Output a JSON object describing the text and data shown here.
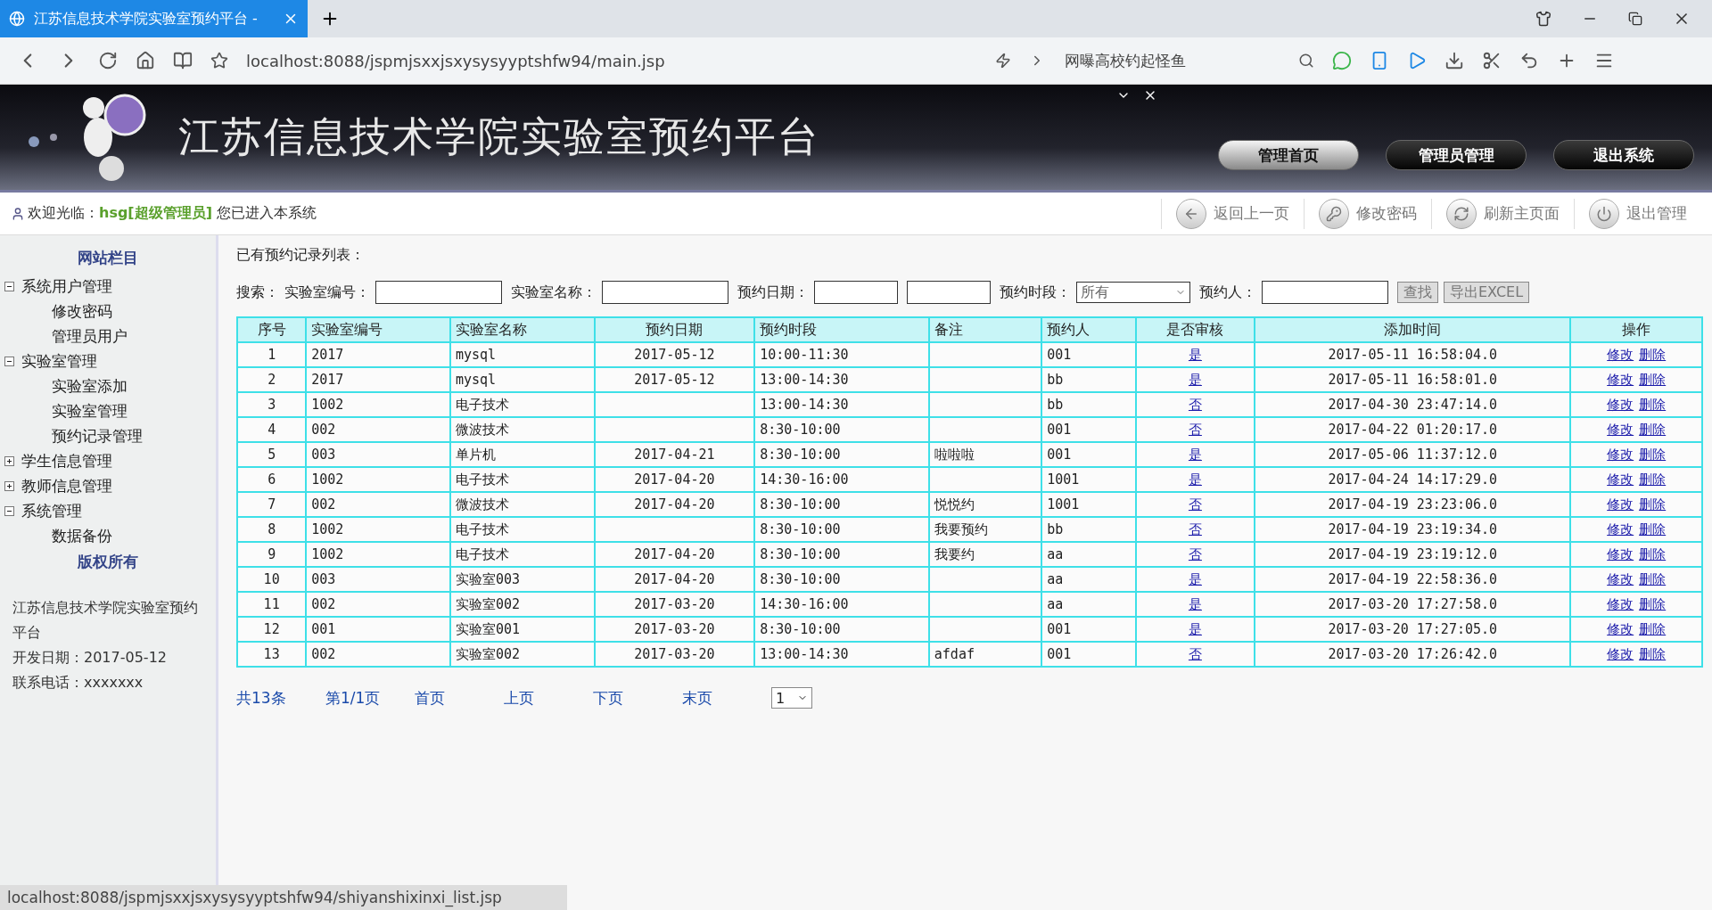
{
  "browser": {
    "tab_title": "江苏信息技术学院实验室预约平台 -",
    "url": "localhost:8088/jspmjsxxjsxysysyyptshfw94/main.jsp",
    "search": {
      "placeholder": "网曝高校钓起怪鱼"
    }
  },
  "header": {
    "title": "江苏信息技术学院实验室预约平台",
    "nav": [
      {
        "label": "管理首页",
        "selected": true
      },
      {
        "label": "管理员管理",
        "selected": false
      },
      {
        "label": "退出系统",
        "selected": false
      }
    ]
  },
  "welcome": {
    "text": "欢迎光临：**hsg[超级管理员]** 您已进入本系统",
    "actions": [
      {
        "label": "返回上一页",
        "kind": "back"
      },
      {
        "label": "修改密码",
        "kind": "key"
      },
      {
        "label": "刷新主页面",
        "kind": "refresh"
      },
      {
        "label": "退出管理",
        "kind": "power"
      }
    ]
  },
  "sidebar": {
    "title": "网站栏目",
    "items": [
      {
        "label": "系统用户管理",
        "expanded": true,
        "children": [
          {
            "label": "修改密码"
          },
          {
            "label": "管理员用户"
          }
        ]
      },
      {
        "label": "实验室管理",
        "expanded": true,
        "children": [
          {
            "label": "实验室添加"
          },
          {
            "label": "实验室管理"
          },
          {
            "label": "预约记录管理"
          }
        ]
      },
      {
        "label": "学生信息管理",
        "expanded": false
      },
      {
        "label": "教师信息管理",
        "expanded": false
      },
      {
        "label": "系统管理",
        "expanded": true,
        "children": [
          {
            "label": "数据备份"
          }
        ]
      }
    ],
    "copyright_title": "版权所有",
    "info": [
      "江苏信息技术学院实验室预约平台",
      "开发日期：2017-05-12",
      "联系电话：xxxxxxx"
    ]
  },
  "main": {
    "heading": "已有预约记录列表：",
    "search_label": "搜索：",
    "filters": [
      {
        "kind": "input",
        "label": "实验室编号："
      },
      {
        "kind": "input",
        "label": "实验室名称："
      },
      {
        "kind": "daterange",
        "label": "预约日期："
      },
      {
        "kind": "select",
        "label": "预约时段：",
        "value": "所有"
      },
      {
        "kind": "input",
        "label": "预约人："
      }
    ],
    "buttons": [
      "查找",
      "导出EXCEL"
    ],
    "table": {
      "columns": [
        "序号",
        "实验室编号",
        "实验室名称",
        "预约日期",
        "预约时段",
        "备注",
        "预约人",
        "是否审核",
        "添加时间",
        "操作"
      ],
      "rows": [
        [
          "1",
          "2017",
          "mysql",
          "2017-05-12",
          "10:00-11:30",
          "",
          "001",
          "是",
          "2017-05-11 16:58:04.0"
        ],
        [
          "2",
          "2017",
          "mysql",
          "2017-05-12",
          "13:00-14:30",
          "",
          "bb",
          "是",
          "2017-05-11 16:58:01.0"
        ],
        [
          "3",
          "1002",
          "电子技术",
          "",
          "13:00-14:30",
          "",
          "bb",
          "否",
          "2017-04-30 23:47:14.0"
        ],
        [
          "4",
          "002",
          "微波技术",
          "",
          "8:30-10:00",
          "",
          "001",
          "否",
          "2017-04-22 01:20:17.0"
        ],
        [
          "5",
          "003",
          "单片机",
          "2017-04-21",
          "8:30-10:00",
          "啦啦啦",
          "001",
          "是",
          "2017-05-06 11:37:12.0"
        ],
        [
          "6",
          "1002",
          "电子技术",
          "2017-04-20",
          "14:30-16:00",
          "",
          "1001",
          "是",
          "2017-04-24 14:17:29.0"
        ],
        [
          "7",
          "002",
          "微波技术",
          "2017-04-20",
          "8:30-10:00",
          "悦悦约",
          "1001",
          "否",
          "2017-04-19 23:23:06.0"
        ],
        [
          "8",
          "1002",
          "电子技术",
          "",
          "8:30-10:00",
          "我要预约",
          "bb",
          "否",
          "2017-04-19 23:19:34.0"
        ],
        [
          "9",
          "1002",
          "电子技术",
          "2017-04-20",
          "8:30-10:00",
          "我要约",
          "aa",
          "否",
          "2017-04-19 23:19:12.0"
        ],
        [
          "10",
          "003",
          "实验室003",
          "2017-04-20",
          "8:30-10:00",
          "",
          "aa",
          "是",
          "2017-04-19 22:58:36.0"
        ],
        [
          "11",
          "002",
          "实验室002",
          "2017-03-20",
          "14:30-16:00",
          "",
          "aa",
          "是",
          "2017-03-20 17:27:58.0"
        ],
        [
          "12",
          "001",
          "实验室001",
          "2017-03-20",
          "8:30-10:00",
          "",
          "001",
          "是",
          "2017-03-20 17:27:05.0"
        ],
        [
          "13",
          "002",
          "实验室002",
          "2017-03-20",
          "13:00-14:30",
          "afdaf",
          "001",
          "否",
          "2017-03-20 17:26:42.0"
        ]
      ],
      "row_actions": [
        [
          "修改",
          "删除"
        ],
        [
          "修改",
          "删除"
        ],
        [
          "修改",
          "删除"
        ],
        [
          "修改",
          "删除"
        ],
        [
          "修改",
          "删除"
        ],
        [
          "修改",
          "删除"
        ],
        [
          "修改",
          "删除"
        ],
        [
          "修改",
          "删除"
        ],
        [
          "修改",
          "删除"
        ],
        [
          "修改",
          "删除"
        ],
        [
          "修改",
          "删除"
        ],
        [
          "修改",
          "删除"
        ],
        [
          "修改",
          "删除"
        ]
      ]
    },
    "pager": {
      "links": [
        "共13条",
        "第1/1页",
        "首页",
        "上页",
        "下页",
        "末页"
      ],
      "page_select": "1"
    }
  },
  "status_url": "localhost:8088/jspmjsxxjsxysysyyptshfw94/shiyanshixinxi_list.jsp"
}
